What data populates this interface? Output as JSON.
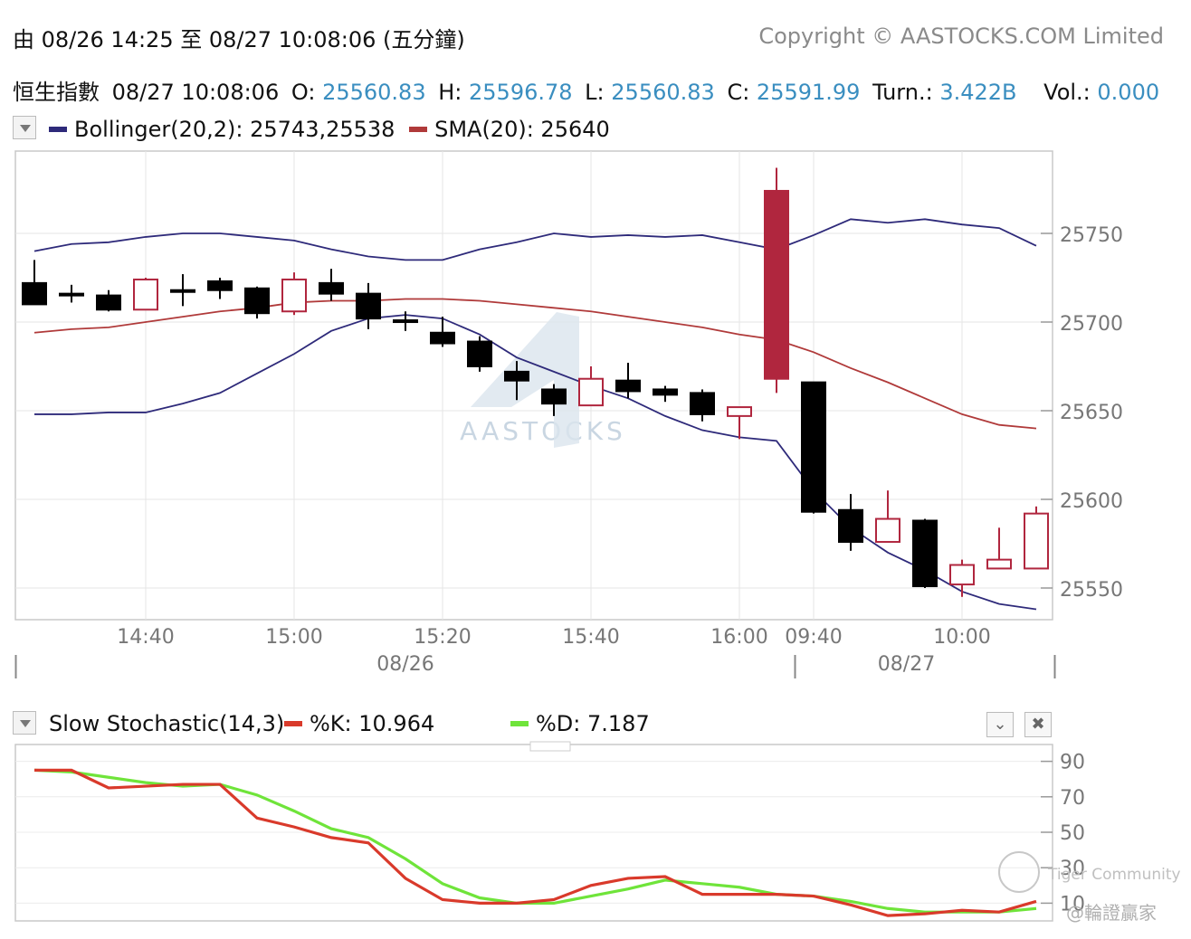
{
  "header": {
    "range_text": "由 08/26 14:25 至 08/27 10:08:06 (五分鐘)",
    "copyright": "Copyright © AASTOCKS.COM Limited"
  },
  "quote": {
    "name": "恒生指數",
    "datetime": "08/27 10:08:06",
    "open_label": "O:",
    "open": "25560.83",
    "high_label": "H:",
    "high": "25596.78",
    "low_label": "L:",
    "low": "25560.83",
    "close_label": "C:",
    "close": "25591.99",
    "turn_label": "Turn.:",
    "turn": "3.422B",
    "vol_label": "Vol.:",
    "vol": "0.000"
  },
  "main_legend": {
    "boll": "Bollinger(20,2): 25743,25538",
    "sma": "SMA(20): 25640"
  },
  "stoch_legend": {
    "title": "Slow Stochastic(14,3)",
    "k": "%K: 10.964",
    "d": "%D: 7.187"
  },
  "watermarks": {
    "aastocks": "AASTOCKS",
    "tiger": "Tiger Community",
    "tiger_cn": "@輪證贏家"
  },
  "icons": {
    "dropdown": "chevron-down-icon",
    "collapse": "collapse-icon",
    "close": "close-icon"
  },
  "colors": {
    "bollinger": "#2e2a7a",
    "sma": "#b03a3a",
    "up": "#b0263e",
    "down": "#000000",
    "k": "#d93a2b",
    "d": "#6fe43a",
    "value": "#3a8ec0"
  },
  "chart_data": [
    {
      "type": "candlestick",
      "title": "",
      "y_ticks": [
        25550,
        25600,
        25650,
        25700,
        25750
      ],
      "ylim": [
        25530,
        25800
      ],
      "x_tick_labels": [
        "14:40",
        "15:00",
        "15:20",
        "15:40",
        "16:00",
        "09:40",
        "10:00"
      ],
      "x_tick_index": [
        3,
        7,
        11,
        15,
        19,
        21,
        25
      ],
      "date_labels": [
        "08/26",
        "08/27"
      ],
      "date_label_index": [
        10,
        23.5
      ],
      "session_separators": [
        -0.5,
        20.5,
        27.5
      ],
      "candles": [
        {
          "o": 25722,
          "h": 25735,
          "l": 25713,
          "c": 25710
        },
        {
          "o": 25716,
          "h": 25721,
          "l": 25711,
          "c": 25716
        },
        {
          "o": 25715,
          "h": 25718,
          "l": 25706,
          "c": 25707
        },
        {
          "o": 25707,
          "h": 25725,
          "l": 25707,
          "c": 25724
        },
        {
          "o": 25718,
          "h": 25727,
          "l": 25709,
          "c": 25718
        },
        {
          "o": 25723,
          "h": 25725,
          "l": 25713,
          "c": 25718
        },
        {
          "o": 25719,
          "h": 25720,
          "l": 25702,
          "c": 25705
        },
        {
          "o": 25706,
          "h": 25728,
          "l": 25704,
          "c": 25724
        },
        {
          "o": 25722,
          "h": 25730,
          "l": 25712,
          "c": 25716
        },
        {
          "o": 25716,
          "h": 25722,
          "l": 25696,
          "c": 25702
        },
        {
          "o": 25701,
          "h": 25706,
          "l": 25695,
          "c": 25701
        },
        {
          "o": 25694,
          "h": 25703,
          "l": 25686,
          "c": 25688
        },
        {
          "o": 25689,
          "h": 25692,
          "l": 25672,
          "c": 25675
        },
        {
          "o": 25672,
          "h": 25678,
          "l": 25656,
          "c": 25667
        },
        {
          "o": 25662,
          "h": 25665,
          "l": 25647,
          "c": 25654
        },
        {
          "o": 25653,
          "h": 25675,
          "l": 25653,
          "c": 25668
        },
        {
          "o": 25667,
          "h": 25677,
          "l": 25657,
          "c": 25661
        },
        {
          "o": 25662,
          "h": 25664,
          "l": 25655,
          "c": 25659
        },
        {
          "o": 25660,
          "h": 25662,
          "l": 25644,
          "c": 25648
        },
        {
          "o": 25647,
          "h": 25652,
          "l": 25634,
          "c": 25652
        },
        {
          "o": 25668,
          "h": 25787,
          "l": 25660,
          "c": 25774
        },
        {
          "o": 25666,
          "h": 25666,
          "l": 25592,
          "c": 25593
        },
        {
          "o": 25594,
          "h": 25603,
          "l": 25571,
          "c": 25576
        },
        {
          "o": 25576,
          "h": 25605,
          "l": 25576,
          "c": 25589
        },
        {
          "o": 25588,
          "h": 25589,
          "l": 25550,
          "c": 25551
        },
        {
          "o": 25552,
          "h": 25566,
          "l": 25545,
          "c": 25563
        },
        {
          "o": 25561,
          "h": 25584,
          "l": 25561,
          "c": 25566
        },
        {
          "o": 25561,
          "h": 25596,
          "l": 25561,
          "c": 25592
        }
      ],
      "series": [
        {
          "name": "Bollinger(20,2)",
          "upper": [
            25740,
            25744,
            25745,
            25748,
            25750,
            25750,
            25748,
            25746,
            25741,
            25737,
            25735,
            25735,
            25741,
            25745,
            25750,
            25748,
            25749,
            25748,
            25749,
            25745,
            25741,
            25749,
            25758,
            25756,
            25758,
            25755,
            25753,
            25743
          ]
        },
        {
          "name": "SMA(20)",
          "values": [
            25694,
            25696,
            25697,
            25700,
            25703,
            25706,
            25708,
            25711,
            25712,
            25712,
            25713,
            25713,
            25712,
            25710,
            25708,
            25706,
            25703,
            25700,
            25697,
            25693,
            25690,
            25683,
            25674,
            25666,
            25657,
            25648,
            25642,
            25640
          ]
        },
        {
          "name": "Bollinger(20,2) lower",
          "lower": [
            25648,
            25648,
            25649,
            25649,
            25654,
            25660,
            25671,
            25682,
            25695,
            25702,
            25704,
            25702,
            25693,
            25680,
            25672,
            25664,
            25657,
            25647,
            25639,
            25635,
            25633,
            25605,
            25584,
            25570,
            25560,
            25548,
            25541,
            25538
          ]
        }
      ]
    },
    {
      "type": "line",
      "title": "Slow Stochastic(14,3)",
      "y_ticks": [
        10,
        30,
        50,
        70,
        90
      ],
      "ylim": [
        0,
        100
      ],
      "series": [
        {
          "name": "%K",
          "values": [
            85,
            85,
            75,
            76,
            77,
            77,
            58,
            53,
            47,
            44,
            24,
            12,
            10,
            10,
            12,
            20,
            24,
            25,
            15,
            15,
            15,
            14,
            9,
            3,
            4,
            6,
            5,
            11
          ]
        },
        {
          "name": "%D",
          "values": [
            85,
            84,
            81,
            78,
            76,
            77,
            71,
            62,
            52,
            47,
            35,
            21,
            13,
            10,
            10,
            14,
            18,
            23,
            21,
            19,
            15,
            14,
            11,
            7,
            5,
            5,
            5,
            7
          ]
        }
      ]
    }
  ]
}
